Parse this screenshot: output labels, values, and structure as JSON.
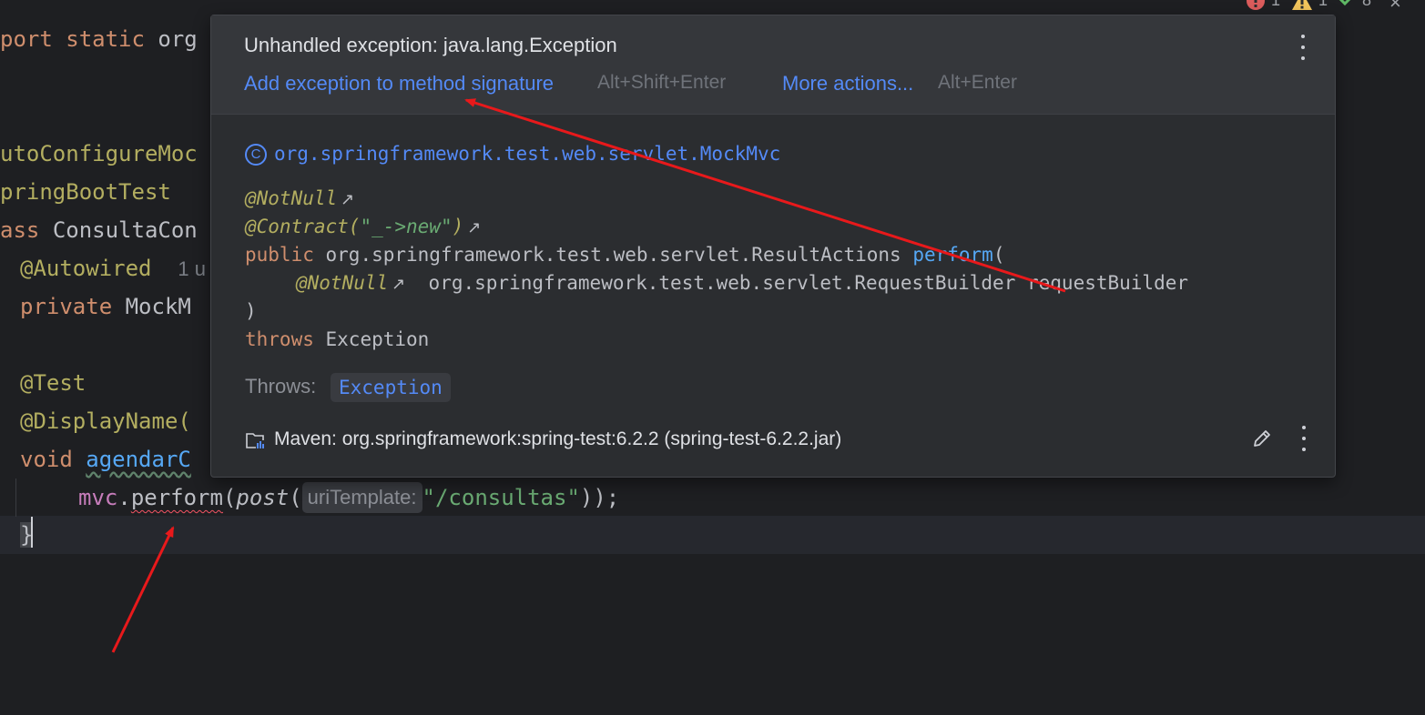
{
  "editor": {
    "lines": {
      "l1": {
        "kw1": "port static",
        "rest": "org"
      },
      "l2": {
        "text": "utoConfigureMoc"
      },
      "l3": {
        "text": "pringBootTest"
      },
      "l4": {
        "kw": "ass",
        "rest": "ConsultaCon"
      },
      "l5": {
        "ann": "@Autowired",
        "hint": "1 u"
      },
      "l6": {
        "kw": "private",
        "rest": "MockM"
      },
      "l7": {
        "ann": "@Test"
      },
      "l8": {
        "ann": "@DisplayName("
      },
      "l9": {
        "kw": "void",
        "method": "agendarC"
      },
      "l10": {
        "field": "mvc",
        "dot": ".",
        "method": "perform",
        "open": "(",
        "call": "post",
        "open2": "(",
        "param_hint": "uriTemplate:",
        "string": "\"/consultas\"",
        "close": "));"
      },
      "l11": {
        "brace": "}"
      }
    }
  },
  "status_bar": {
    "errors": "1",
    "warnings": "1",
    "checks": "8",
    "close": "×"
  },
  "popup": {
    "title": "Unhandled exception: java.lang.Exception",
    "action_primary": "Add exception to method signature",
    "action_primary_shortcut": "Alt+Shift+Enter",
    "action_more": "More actions...",
    "action_more_shortcut": "Alt+Enter",
    "doc": {
      "class_icon": "C",
      "class_name": "org.springframework.test.web.servlet.MockMvc",
      "annotation1": "@NotNull",
      "annotation2_name": "@Contract(",
      "annotation2_value": "\"_->new\"",
      "annotation2_close": ")",
      "ext_arrow": "↗",
      "signature_kw": "public",
      "signature_type": "org.springframework.test.web.servlet.ResultActions",
      "signature_method": "perform",
      "signature_open": "(",
      "param_annotation": "@NotNull",
      "param_type": "org.springframework.test.web.servlet.RequestBuilder",
      "param_name": "requestBuilder",
      "signature_close": ")",
      "throws_kw": "throws",
      "throws_type": "Exception",
      "throws_label": "Throws:",
      "throws_chip": "Exception",
      "maven_source": "Maven: org.springframework:spring-test:6.2.2 (spring-test-6.2.2.jar)"
    }
  },
  "colors": {
    "background": "#1e1f22",
    "popup_bg": "#2b2d30",
    "popup_header_bg": "#35373b",
    "link": "#548af7",
    "keyword": "#cf8e6d",
    "annotation": "#b3ae60",
    "field": "#c77dbb",
    "method": "#56a8f5",
    "string": "#6aab73",
    "arrow": "#e8191b"
  }
}
